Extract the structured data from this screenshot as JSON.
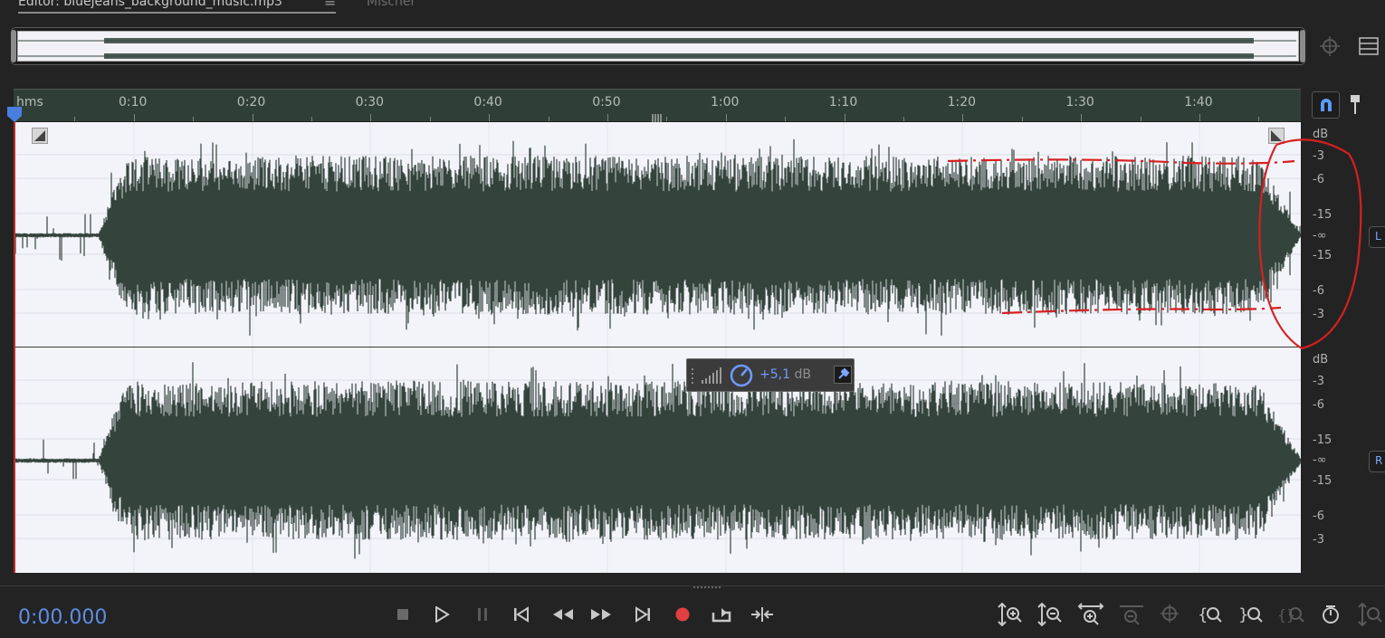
{
  "tabs": {
    "editor_label": "Editor: bluejeans_background_music.mp3",
    "mixer_label": "Mischer",
    "menu_glyph": "≡"
  },
  "ruler": {
    "start_label": "hms",
    "labels": [
      "0:10",
      "0:20",
      "0:30",
      "0:40",
      "0:50",
      "1:00",
      "1:10",
      "1:20",
      "1:30",
      "1:40"
    ]
  },
  "db_scale": {
    "unit": "dB",
    "left_labels": [
      "-3",
      "-6",
      "-15",
      "-∞",
      "-15",
      "-6",
      "-3"
    ],
    "right_labels": [
      "-3",
      "-6",
      "-15",
      "-∞",
      "-15",
      "-6",
      "-3"
    ]
  },
  "channels": {
    "left_tag": "L",
    "right_tag": "R"
  },
  "gain_hud": {
    "value": "+5,1",
    "unit": "dB"
  },
  "transport": {
    "time": "0:00.000"
  },
  "colors": {
    "waveform": "#34443c",
    "waveform_bg": "#f3f3fa",
    "ruler_bg": "#2f3f37",
    "accent_blue": "#5c8ee6",
    "record_red": "#e04040",
    "annotation_red": "#d62020"
  },
  "icons": {
    "zoom_icons": [
      "zoom-in-amplitude-icon",
      "zoom-out-amplitude-icon",
      "zoom-in-time-icon",
      "zoom-out-time-icon",
      "zoom-selection-icon",
      "zoom-in-left-edge-icon",
      "zoom-in-right-edge-icon",
      "zoom-out-full-icon",
      "zoom-reset-icon",
      "zoom-all-amplitude-icon"
    ]
  }
}
